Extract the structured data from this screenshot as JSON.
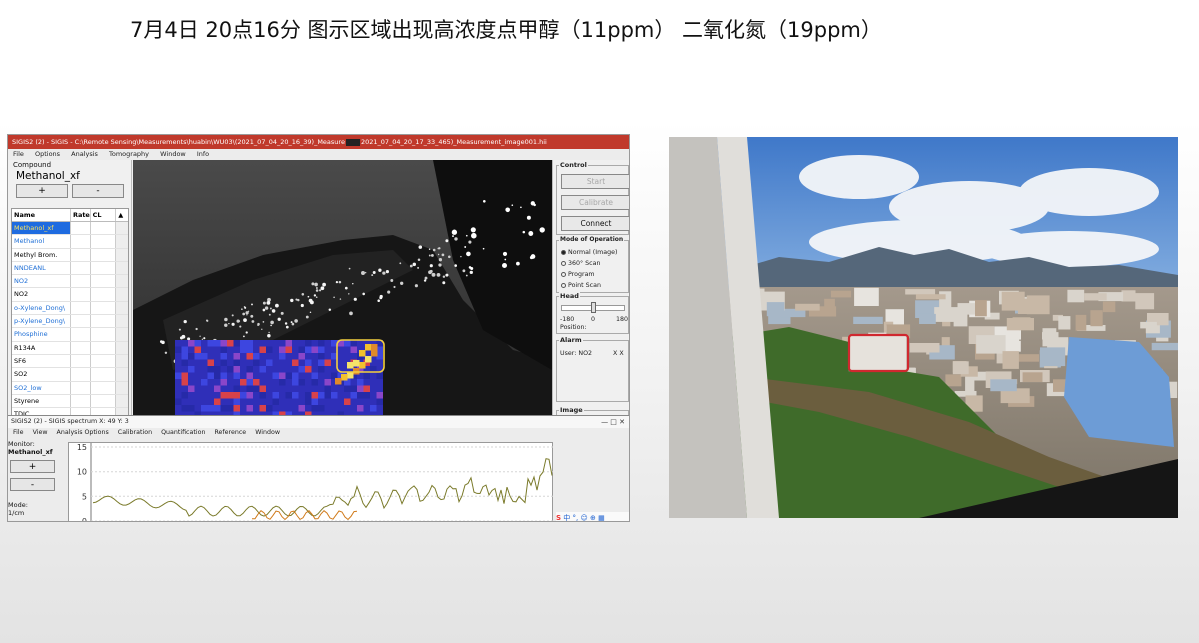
{
  "slide": {
    "title": "7月4日 20点16分 图示区域出现高浓度点甲醇（11ppm） 二氧化氮（19ppm）"
  },
  "app": {
    "window_title_a": "SIGIS2 (2) - SIGIS - C:\\Remote Sensing\\Measurements\\huabin\\WU03\\(2021_07_04_20_16_39)_Measure",
    "window_title_b": "2021_07_04_20_17_33_465)_Measurement_image001.hii",
    "menu": [
      "File",
      "Options",
      "Analysis",
      "Tomography",
      "Window",
      "Info"
    ],
    "compound_label": "Compound",
    "compound_value": "Methanol_xf",
    "plus": "+",
    "minus": "-",
    "table_headers": [
      "Name",
      "Rate",
      "CL",
      "▲"
    ],
    "gases": [
      {
        "name": "Methanol_xf",
        "style": "sel"
      },
      {
        "name": "Methanol",
        "style": "blue"
      },
      {
        "name": "Methyl Brom.",
        "style": ""
      },
      {
        "name": "NNDEANL",
        "style": "blue"
      },
      {
        "name": "NO2",
        "style": "blue"
      },
      {
        "name": "NO2",
        "style": ""
      },
      {
        "name": "o-Xylene_Dong\\",
        "style": "blue"
      },
      {
        "name": "p-Xylene_Dong\\",
        "style": "blue"
      },
      {
        "name": "Phosphine",
        "style": "blue"
      },
      {
        "name": "R134A",
        "style": ""
      },
      {
        "name": "SF6",
        "style": ""
      },
      {
        "name": "SO2",
        "style": ""
      },
      {
        "name": "SO2_low",
        "style": "blue"
      },
      {
        "name": "Styrene",
        "style": ""
      },
      {
        "name": "TDIC",
        "style": ""
      }
    ],
    "control": {
      "title": "Control",
      "start": "Start",
      "calibrate": "Calibrate",
      "connect": "Connect"
    },
    "mode": {
      "title": "Mode of Operation",
      "options": [
        "Normal (Image)",
        "360° Scan",
        "Program",
        "Point Scan"
      ],
      "selected_index": 0
    },
    "head": {
      "title": "Head",
      "min": "-180",
      "mid": "0",
      "max": "180",
      "position_label": "Position:"
    },
    "alarm": {
      "title": "Alarm",
      "user": "User: NO2",
      "value": "X X"
    },
    "image_group_title": "Image"
  },
  "spectrum": {
    "title": "SIGIS2 (2) - SIGIS spectrum X: 49 Y: 3",
    "window_controls": "—  □  ✕",
    "menu": [
      "File",
      "View",
      "Analysis Options",
      "Calibration",
      "Quantification",
      "Reference",
      "Window"
    ],
    "monitor_label": "Monitor:",
    "monitor_value": "Methanol_xf",
    "plus": "+",
    "minus": "-",
    "mode_label": "Mode:",
    "unit_label": "1/cm",
    "y_ticks": [
      "15",
      "10",
      "5",
      "0"
    ],
    "ime_text": "中 °, ☺ ⊕ ▦",
    "ime_logo": "S"
  },
  "colors": {
    "window_title_red": "#c0392b",
    "selection_blue": "#1e6be0",
    "gas_blue_text": "#1f6fd6",
    "highlight_yellow": "#f4d03f",
    "photo_box_red": "#d0282f",
    "spectrum_green": "#7a7a2a",
    "spectrum_orange": "#d07a1a"
  },
  "icons": [
    "radio-icon",
    "ime-logo-icon",
    "scrollbar-arrow-icon"
  ]
}
